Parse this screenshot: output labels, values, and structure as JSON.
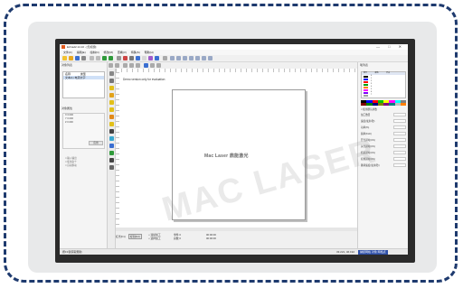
{
  "app": {
    "title": "EzCad2.14.10 - [无标题]",
    "window_controls": "— □ ✕"
  },
  "menu": [
    "文件(F)",
    "编辑(E)",
    "绘制(D)",
    "修改(M)",
    "查看(V)",
    "特殊(S)",
    "帮助(H)"
  ],
  "left_panel": {
    "header": "对象列表",
    "list_header": [
      "名称",
      "类型"
    ],
    "items": [
      "文本(1) 电源文字"
    ],
    "prop_header": "对象属性",
    "prop_rows": [
      "X  0.000",
      "Y  0.000",
      "Z  0.000"
    ],
    "apply_label": "应用",
    "checks": [
      "□ 输入输出",
      "□ 使用多个",
      "□ 自动移动"
    ]
  },
  "canvas": {
    "eval_note": "Demo version only for evaluation",
    "logo_text": "Mac Laser 鼎能激光",
    "watermark": "MAC LASER"
  },
  "bottom_bar": {
    "mark_label": "红光(F1)",
    "mark_button": "标刻(F2)",
    "opt1": "□ 连续加工",
    "opt2": "□ 选择加工",
    "part_label": "零件 0",
    "total_label": "总数 0",
    "time1": "00:00:00",
    "time2": "00:00:00"
  },
  "right_panel": {
    "header": "笔列表",
    "layer_headers": [
      "笔号",
      "颜色",
      "开关"
    ],
    "layers": [
      {
        "name": "0",
        "color": "#000000"
      },
      {
        "name": "1",
        "color": "#0000ff"
      },
      {
        "name": "2",
        "color": "#ff0000"
      },
      {
        "name": "3",
        "color": "#00a000"
      },
      {
        "name": "4",
        "color": "#ff8000"
      },
      {
        "name": "5",
        "color": "#ff00ff"
      },
      {
        "name": "6",
        "color": "#8000ff"
      },
      {
        "name": "7",
        "color": "#a0a0a0"
      }
    ],
    "palette": [
      "#000000",
      "#0000ff",
      "#ff0000",
      "#00c000",
      "#ffff00",
      "#ff00ff",
      "#00ffff",
      "#808080",
      "#800000",
      "#008000",
      "#000080",
      "#808000",
      "#800080",
      "#008080",
      "#c0c0c0",
      "#ff8000"
    ],
    "params": [
      "加工数目",
      "速度(毫米/秒)",
      "功率(%)",
      "频率(KHz)",
      "开光延时(US)",
      "关光延时(US)",
      "结束延时(US)",
      "拐角延时(US)",
      "跳转速度(毫米/秒)"
    ],
    "use_default": "□ 使用默认参数"
  },
  "status": {
    "left": "按F1键获取帮助",
    "coords": "33.221, 46.192",
    "mode": "捕捉网格 对象 网格点"
  }
}
